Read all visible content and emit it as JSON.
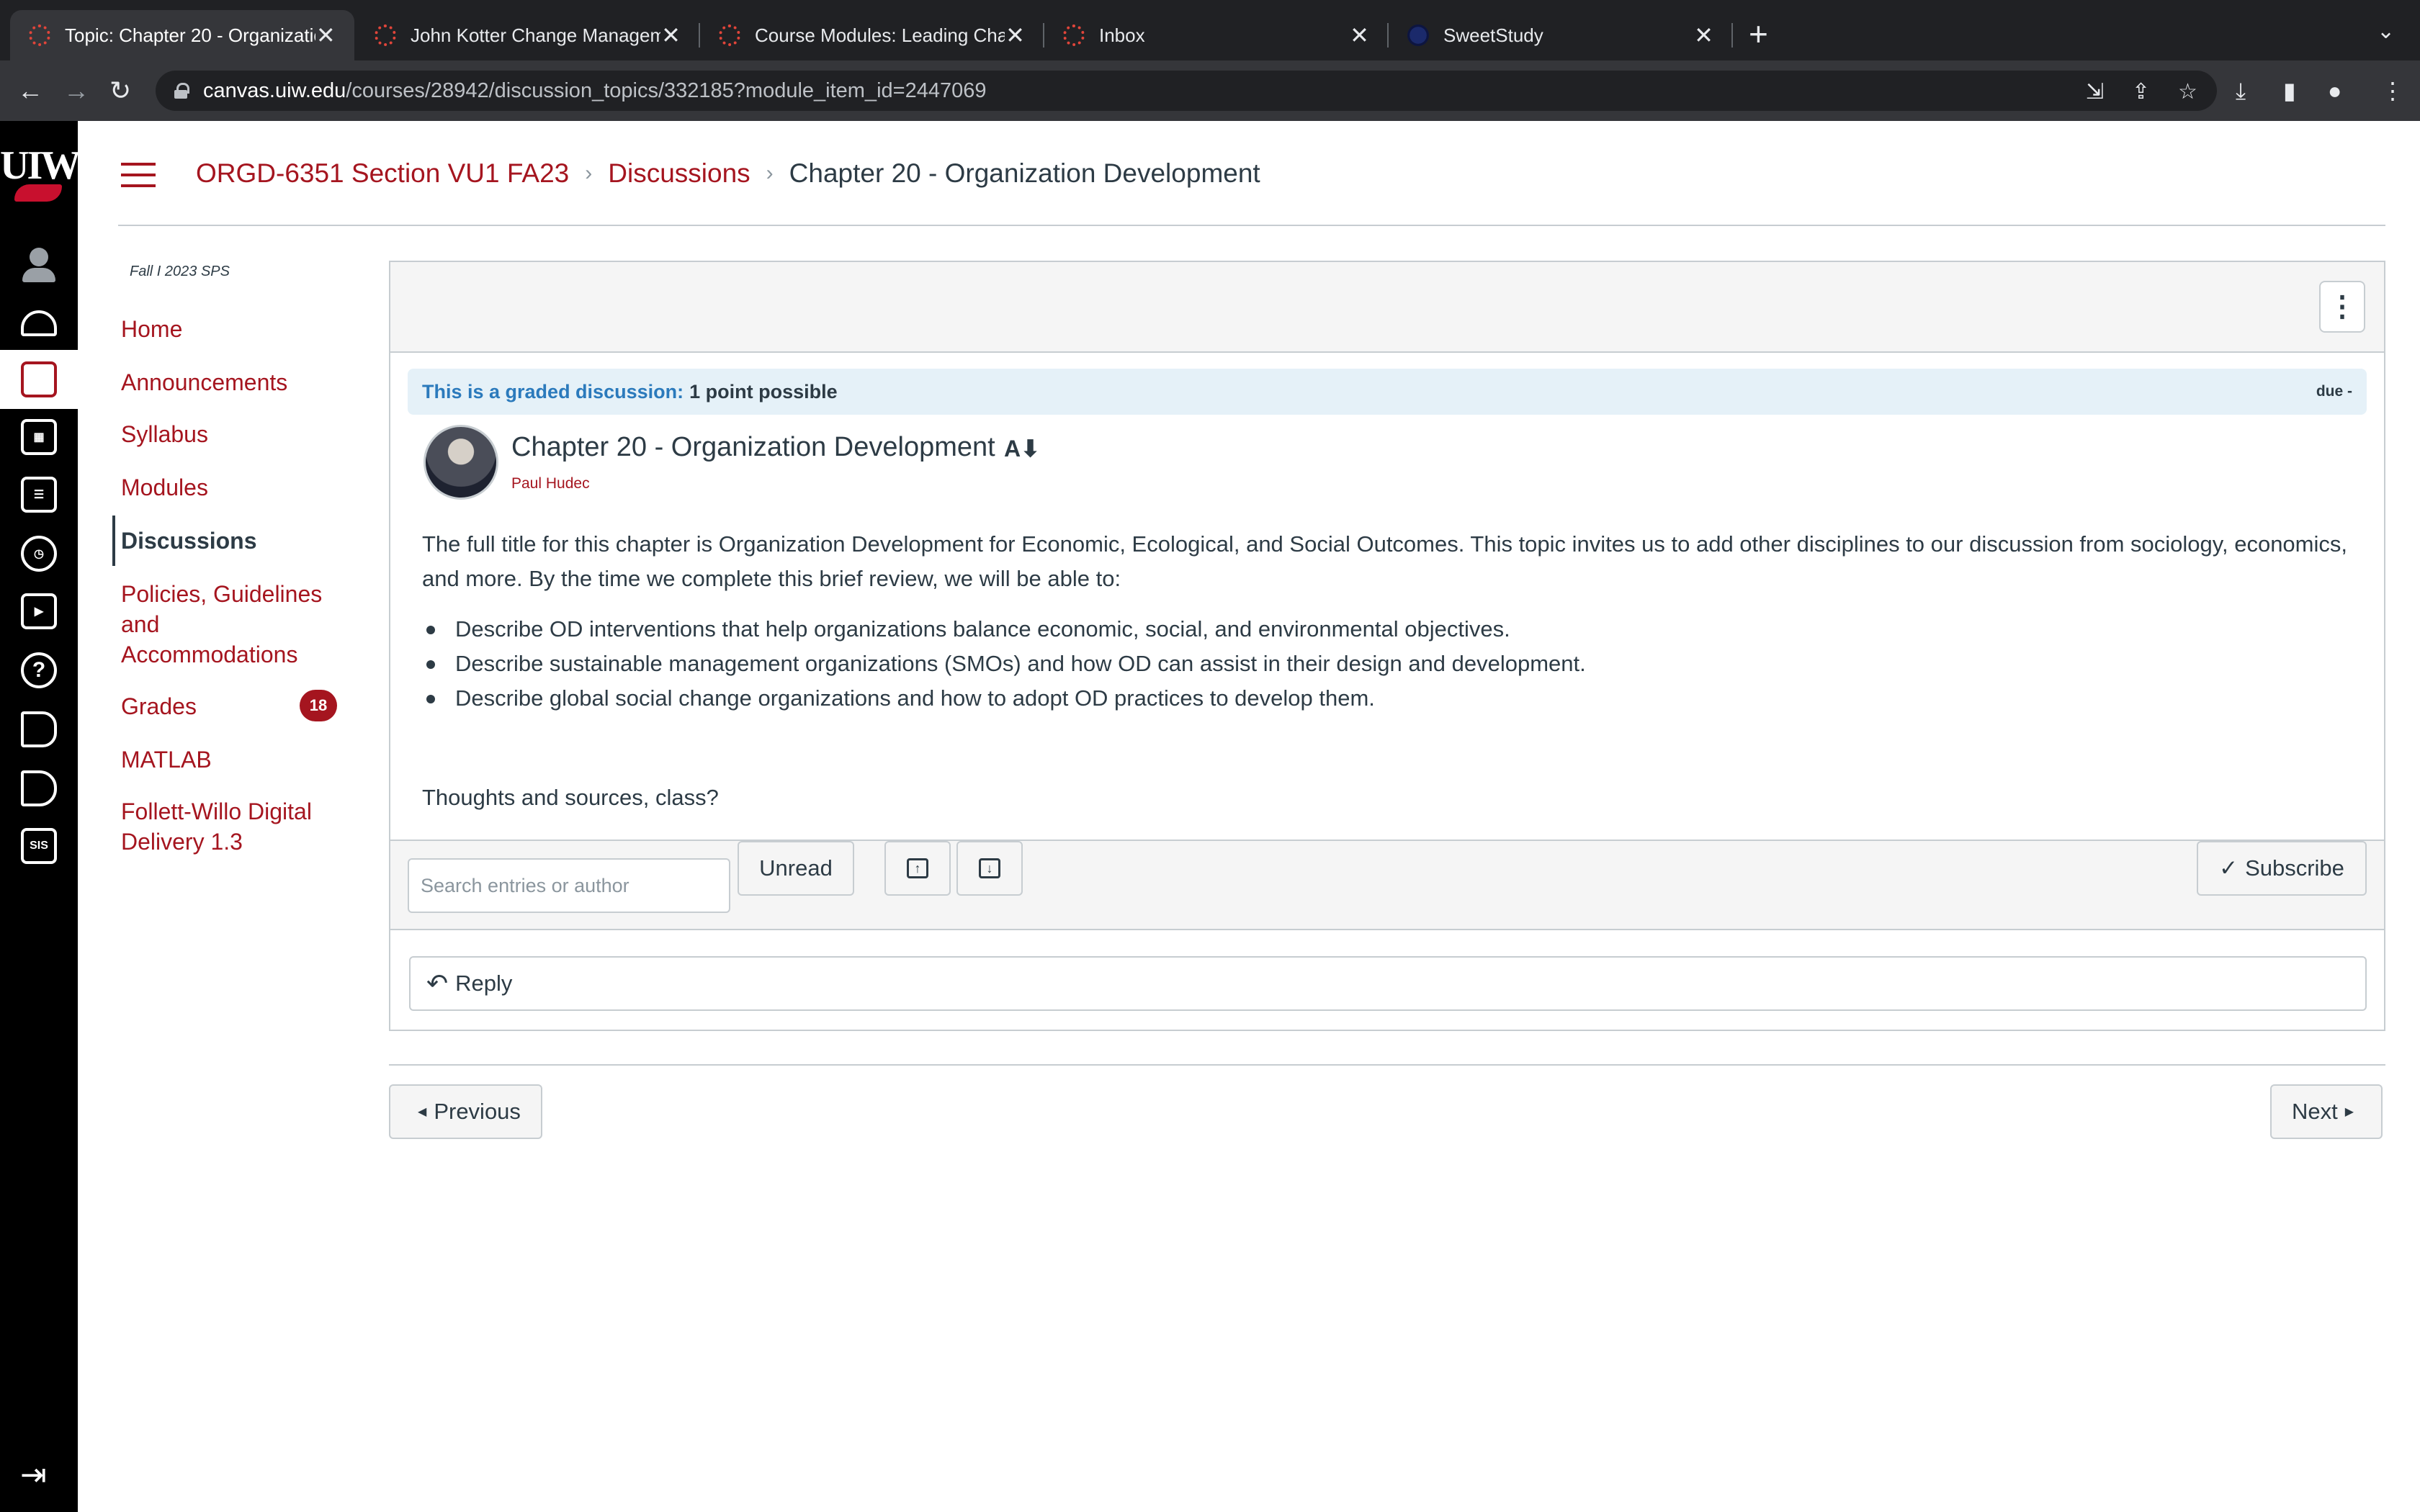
{
  "browser": {
    "tabs": [
      {
        "title": "Topic: Chapter 20 - Organizatio",
        "active": true
      },
      {
        "title": "John Kotter Change Manageme",
        "active": false
      },
      {
        "title": "Course Modules: Leading Char",
        "active": false
      },
      {
        "title": "Inbox",
        "active": false
      },
      {
        "title": "SweetStudy",
        "active": false
      }
    ],
    "url_host": "canvas.uiw.edu",
    "url_path": "/courses/28942/discussion_topics/332185?module_item_id=2447069"
  },
  "global_nav": {
    "logo": "UIW",
    "items": [
      "account",
      "dashboard",
      "courses",
      "calendar",
      "inbox",
      "history",
      "studio",
      "help",
      "announcements",
      "audio",
      "sis"
    ]
  },
  "breadcrumb": {
    "course": "ORGD-6351 Section VU1 FA23",
    "section": "Discussions",
    "current": "Chapter 20 - Organization Development"
  },
  "course_nav": {
    "term": "Fall I 2023 SPS",
    "items": [
      {
        "label": "Home"
      },
      {
        "label": "Announcements"
      },
      {
        "label": "Syllabus"
      },
      {
        "label": "Modules"
      },
      {
        "label": "Discussions"
      },
      {
        "label": "Policies, Guidelines and Accommodations"
      },
      {
        "label": "Grades",
        "badge": "18"
      },
      {
        "label": "MATLAB"
      },
      {
        "label": "Follett-Willo Digital Delivery 1.3"
      }
    ]
  },
  "discussion": {
    "graded_label": "This is a graded discussion:",
    "points": "1 point possible",
    "due": "due -",
    "title": "Chapter 20 - Organization Development",
    "author": "Paul Hudec",
    "intro": "The full title for this chapter is Organization Development for Economic, Ecological, and Social Outcomes.  This topic invites us to add other disciplines to our discussion from sociology, economics, and more.  By the time we complete this brief review, we will be able to:",
    "objectives": [
      "Describe OD interventions that help organizations balance economic, social, and environmental objectives.",
      "Describe sustainable management organizations (SMOs) and how OD can assist in their design and development.",
      "Describe global social change organizations and how to adopt OD practices to develop them."
    ],
    "closing": "Thoughts and sources, class?"
  },
  "actions": {
    "search_placeholder": "Search entries or author",
    "unread_label": "Unread",
    "subscribe_label": "Subscribe",
    "reply_label": "Reply"
  },
  "pager": {
    "previous_label": "Previous",
    "next_label": "Next"
  }
}
